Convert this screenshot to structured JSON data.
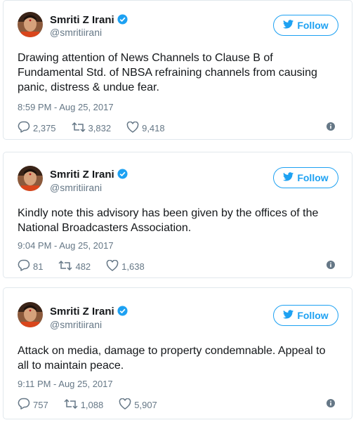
{
  "colors": {
    "accent": "#1da1f2",
    "text": "#14171a",
    "muted": "#657786",
    "border": "#e1e8ed"
  },
  "tweets": [
    {
      "name": "Smriti Z Irani",
      "handle": "@smritiirani",
      "follow_label": "Follow",
      "text": "Drawing attention of News Channels to Clause B of Fundamental Std. of NBSA refraining channels from causing panic, distress & undue fear.",
      "time": "8:59 PM - Aug 25, 2017",
      "replies": "2,375",
      "retweets": "3,832",
      "likes": "9,418"
    },
    {
      "name": "Smriti Z Irani",
      "handle": "@smritiirani",
      "follow_label": "Follow",
      "text": "Kindly note this advisory has been given by the offices of the National Broadcasters Association.",
      "time": "9:04 PM - Aug 25, 2017",
      "replies": "81",
      "retweets": "482",
      "likes": "1,638"
    },
    {
      "name": "Smriti Z Irani",
      "handle": "@smritiirani",
      "follow_label": "Follow",
      "text": "Attack on media, damage to property condemnable. Appeal to all to maintain peace.",
      "time": "9:11 PM - Aug 25, 2017",
      "replies": "757",
      "retweets": "1,088",
      "likes": "5,907"
    }
  ]
}
